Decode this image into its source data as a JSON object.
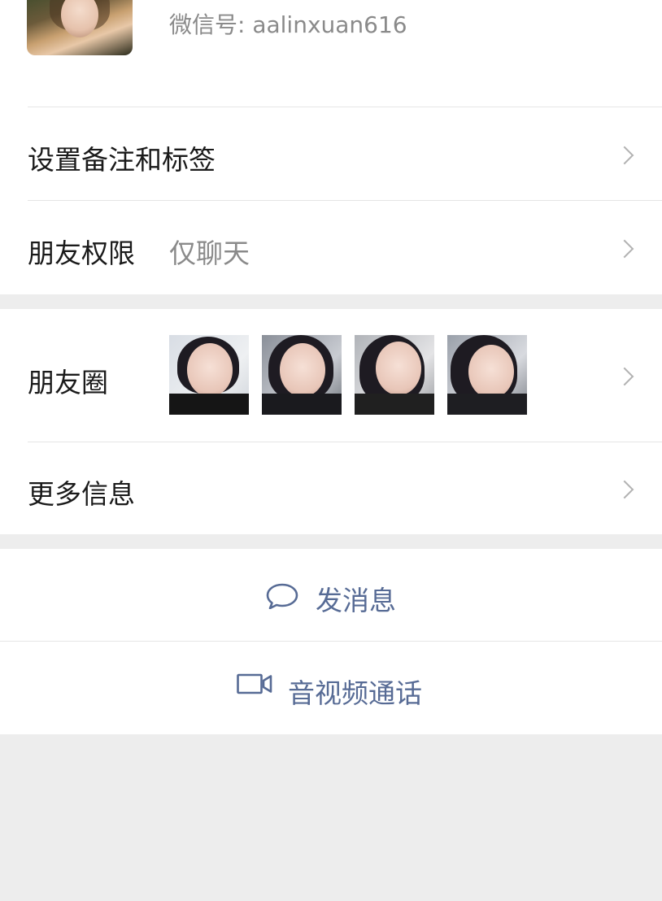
{
  "profile": {
    "wechat_id_label": "微信号: aalinxuan616"
  },
  "rows": {
    "remark_label": "设置备注和标签",
    "permission_label": "朋友权限",
    "permission_value": "仅聊天",
    "moments_label": "朋友圈",
    "more_label": "更多信息"
  },
  "moments": {
    "photo_count": 4
  },
  "actions": {
    "message_label": "发消息",
    "call_label": "音视频通话"
  },
  "colors": {
    "link": "#576b95",
    "background": "#ededed",
    "secondary_text": "#8a8a8a"
  },
  "icons": {
    "message": "chat-bubble-icon",
    "call": "video-camera-icon",
    "row": "chevron-right-icon"
  }
}
